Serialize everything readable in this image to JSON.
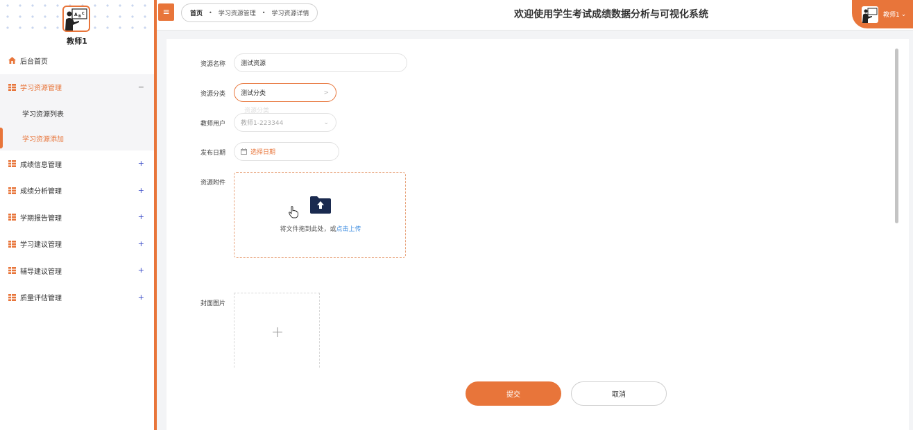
{
  "sidebar": {
    "user_name": "教师1",
    "menu": [
      {
        "label": "后台首页",
        "icon": "home-icon"
      },
      {
        "label": "学习资源管理",
        "icon": "grid-icon",
        "toggle": "−",
        "expanded": true,
        "children": [
          {
            "label": "学习资源列表"
          },
          {
            "label": "学习资源添加",
            "active": true
          }
        ]
      },
      {
        "label": "成绩信息管理",
        "icon": "grid-icon",
        "toggle": "+"
      },
      {
        "label": "成绩分析管理",
        "icon": "grid-icon",
        "toggle": "+"
      },
      {
        "label": "学期报告管理",
        "icon": "grid-icon",
        "toggle": "+"
      },
      {
        "label": "学习建议管理",
        "icon": "grid-icon",
        "toggle": "+"
      },
      {
        "label": "辅导建议管理",
        "icon": "grid-icon",
        "toggle": "+"
      },
      {
        "label": "质量评估管理",
        "icon": "grid-icon",
        "toggle": "+"
      }
    ]
  },
  "header": {
    "menu_icon": "≡",
    "breadcrumb": [
      "首页",
      "学习资源管理",
      "学习资源详情"
    ],
    "title": "欢迎使用学生考试成绩数据分析与可视化系统",
    "user_label": "教师1",
    "user_caret": "⌄"
  },
  "form": {
    "name_label": "资源名称",
    "name_value": "测试资源",
    "category_label": "资源分类",
    "category_value": "测试分类",
    "teacher_label": "教师用户",
    "teacher_value": "教师1-223344",
    "ghost_text": "资源分类",
    "date_label": "发布日期",
    "date_placeholder": "选择日期",
    "attachment_label": "资源附件",
    "upload_text": "将文件拖到此处，或",
    "upload_link": "点击上传",
    "cover_label": "封面图片",
    "cover_plus": "+"
  },
  "buttons": {
    "submit": "提交",
    "cancel": "取消"
  },
  "colors": {
    "accent": "#e8753a",
    "link": "#3b8be0",
    "toggle": "#3a4cc8"
  }
}
